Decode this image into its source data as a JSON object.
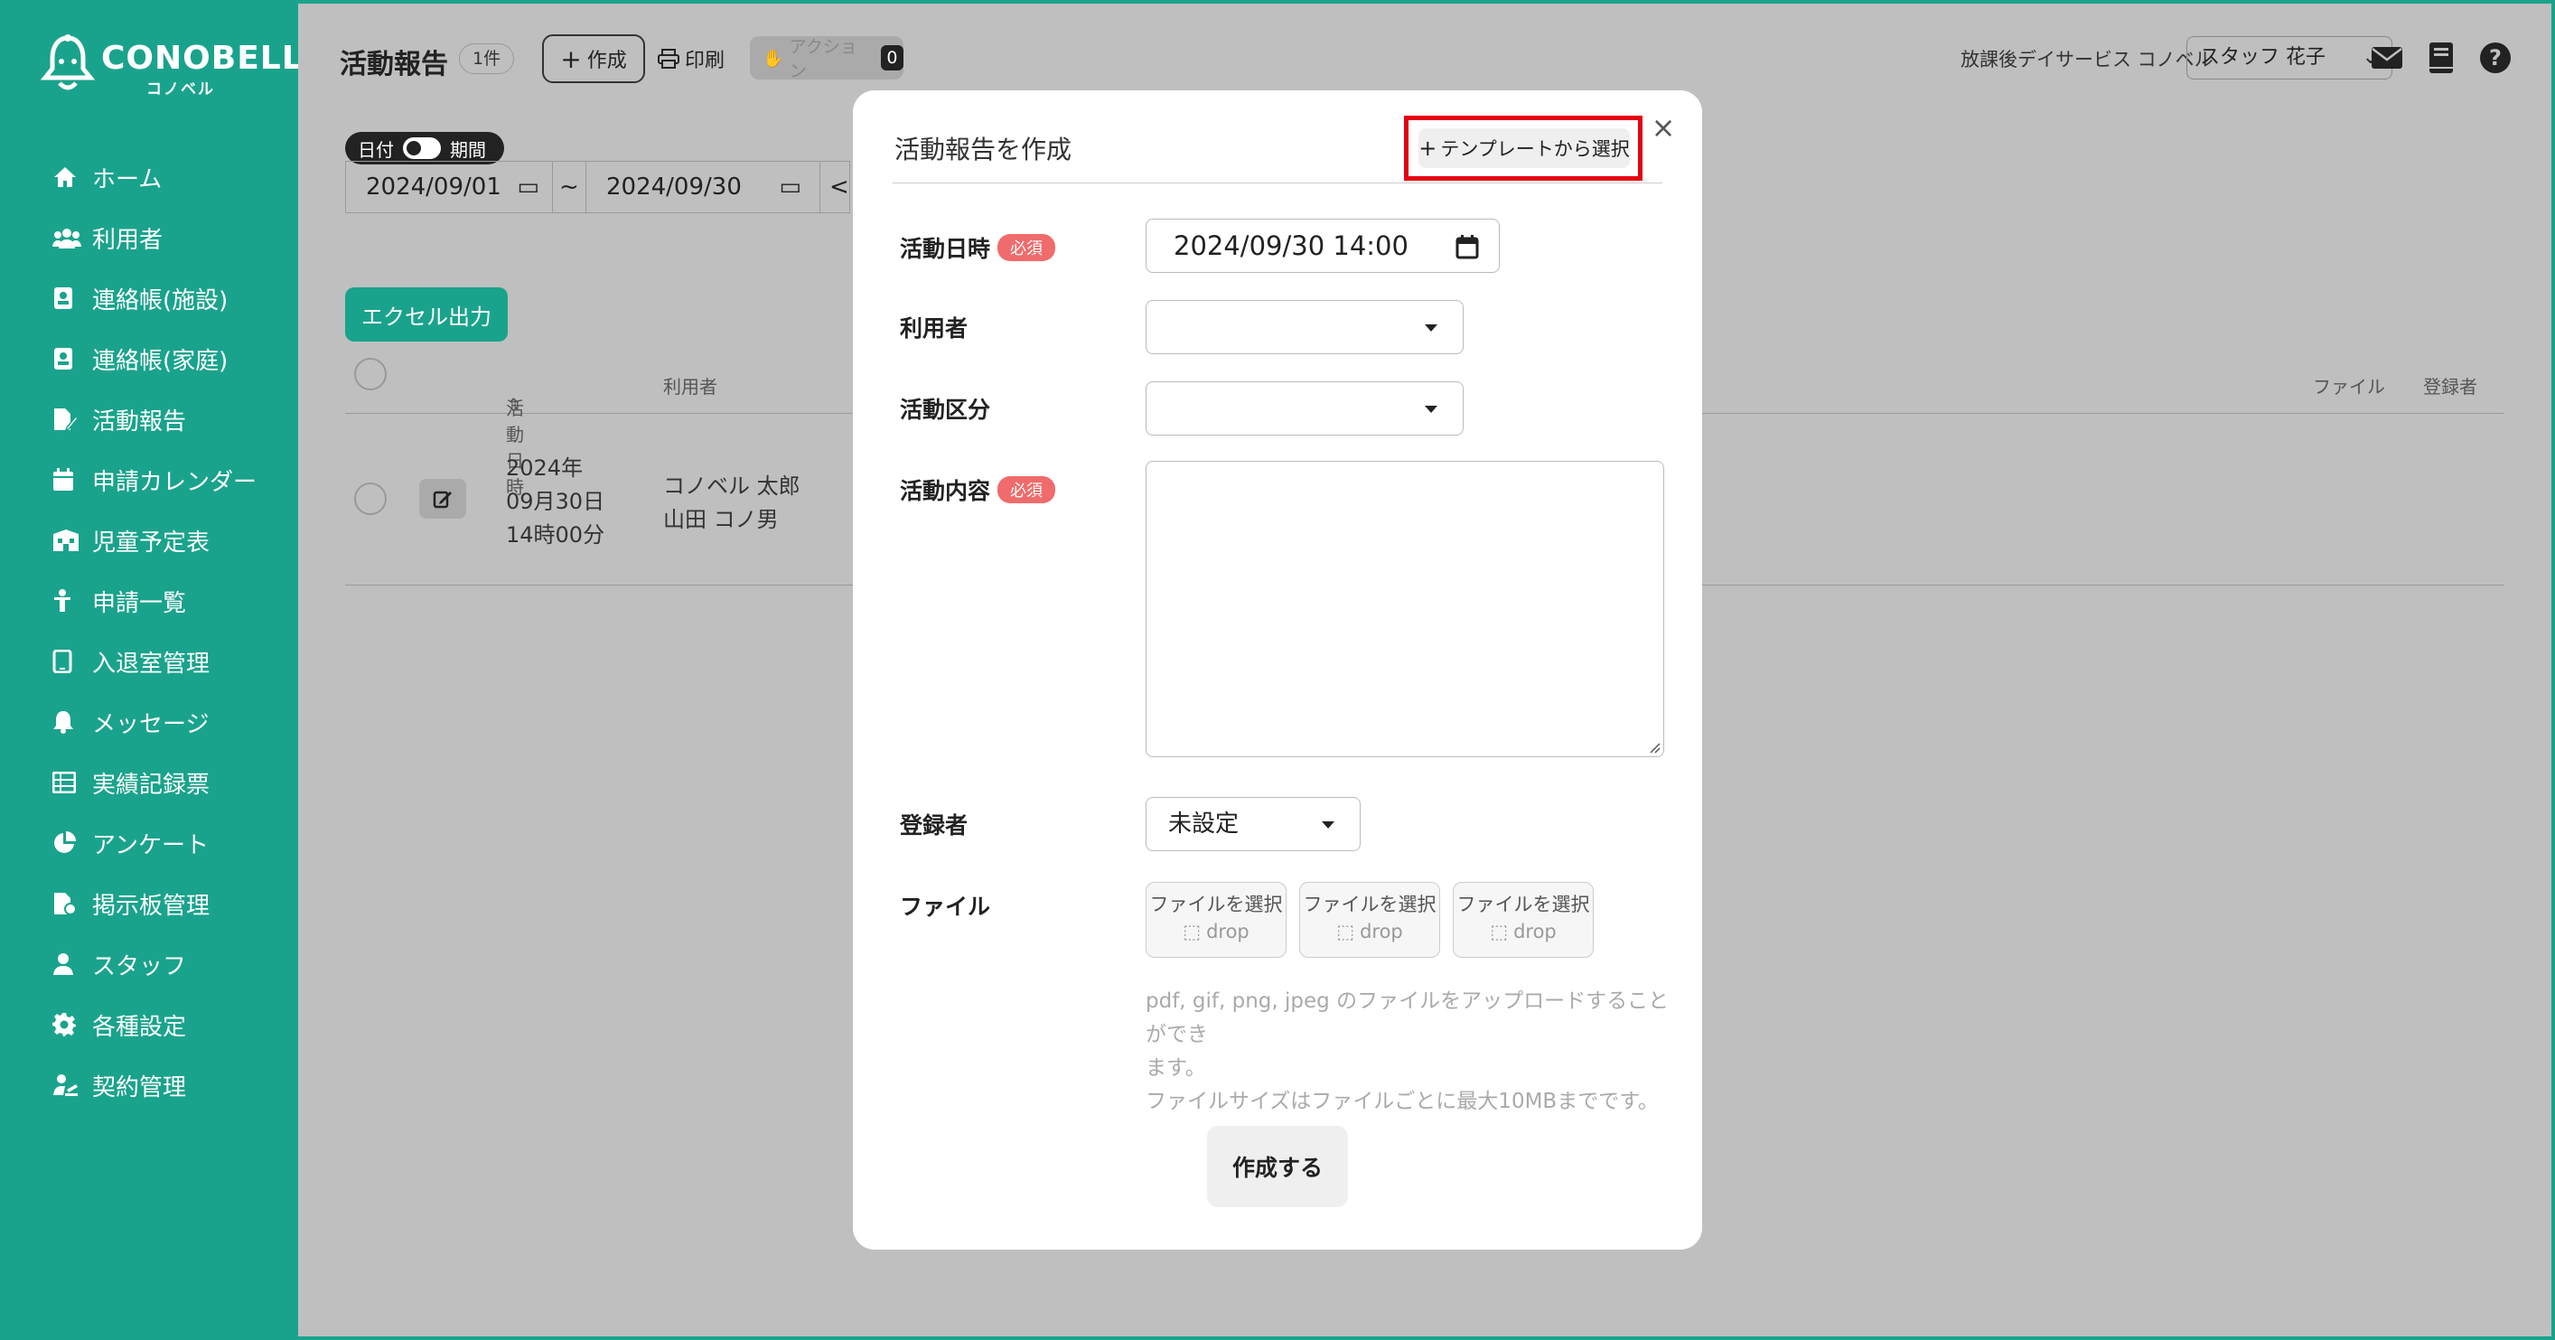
{
  "brand": {
    "name": "CONOBELL",
    "subname": "コノベル"
  },
  "sidebar": {
    "items": [
      {
        "label": "ホーム",
        "icon": "home-icon"
      },
      {
        "label": "利用者",
        "icon": "users-icon"
      },
      {
        "label": "連絡帳(施設)",
        "icon": "contact-book-icon"
      },
      {
        "label": "連絡帳(家庭)",
        "icon": "contact-book-icon"
      },
      {
        "label": "活動報告",
        "icon": "report-edit-icon"
      },
      {
        "label": "申請カレンダー",
        "icon": "calendar-icon"
      },
      {
        "label": "児童予定表",
        "icon": "schedule-icon"
      },
      {
        "label": "申請一覧",
        "icon": "child-icon"
      },
      {
        "label": "入退室管理",
        "icon": "tablet-icon"
      },
      {
        "label": "メッセージ",
        "icon": "bell-icon"
      },
      {
        "label": "実績記録票",
        "icon": "table-icon"
      },
      {
        "label": "アンケート",
        "icon": "pie-chart-icon"
      },
      {
        "label": "掲示板管理",
        "icon": "bulletin-icon"
      },
      {
        "label": "スタッフ",
        "icon": "person-icon"
      },
      {
        "label": "各種設定",
        "icon": "gear-icon"
      },
      {
        "label": "契約管理",
        "icon": "contract-icon"
      }
    ]
  },
  "header": {
    "title": "活動報告",
    "count": "1件",
    "create_label": "作成",
    "print_label": "印刷",
    "action_label": "アクション",
    "action_count": "0",
    "facility": "放課後デイサービス コノベル",
    "staff": "スタッフ 花子"
  },
  "filters": {
    "toggle_left": "日付",
    "toggle_right": "期間",
    "date_from": "2024/09/01",
    "separator": "~",
    "date_to": "2024/09/30",
    "prev": "<"
  },
  "list": {
    "excel_label": "エクセル出力",
    "columns": [
      "活動日時",
      "利用者",
      "ファイル",
      "登録者"
    ],
    "rows": [
      {
        "date_line1": "2024年",
        "date_line2": "09月30日",
        "date_line3": "14時00分",
        "user_line1": "コノベル 太郎",
        "user_line2": "山田 コノ男"
      }
    ]
  },
  "modal": {
    "title": "活動報告を作成",
    "template_button": "テンプレートから選択",
    "close": "×",
    "required_badge": "必須",
    "fields": {
      "datetime_label": "活動日時",
      "datetime_value": "2024/09/30 14:00",
      "user_label": "利用者",
      "user_value": "",
      "category_label": "活動区分",
      "category_value": "",
      "content_label": "活動内容",
      "registrant_label": "登録者",
      "registrant_value": "未設定",
      "file_label": "ファイル"
    },
    "file_slots": [
      {
        "label": "ファイルを選択",
        "drop": "drop"
      },
      {
        "label": "ファイルを選択",
        "drop": "drop"
      },
      {
        "label": "ファイルを選択",
        "drop": "drop"
      }
    ],
    "hint_line1": "pdf, gif, png, jpeg のファイルをアップロードすることができ",
    "hint_line2": "ます。",
    "hint_line3": "ファイルサイズはファイルごとに最大10MBまでです。",
    "submit_label": "作成する"
  },
  "colors": {
    "brand": "#1aa38c",
    "required": "#f06b6b",
    "highlight": "#e60012",
    "overlay_bg": "#bfbfbf"
  }
}
